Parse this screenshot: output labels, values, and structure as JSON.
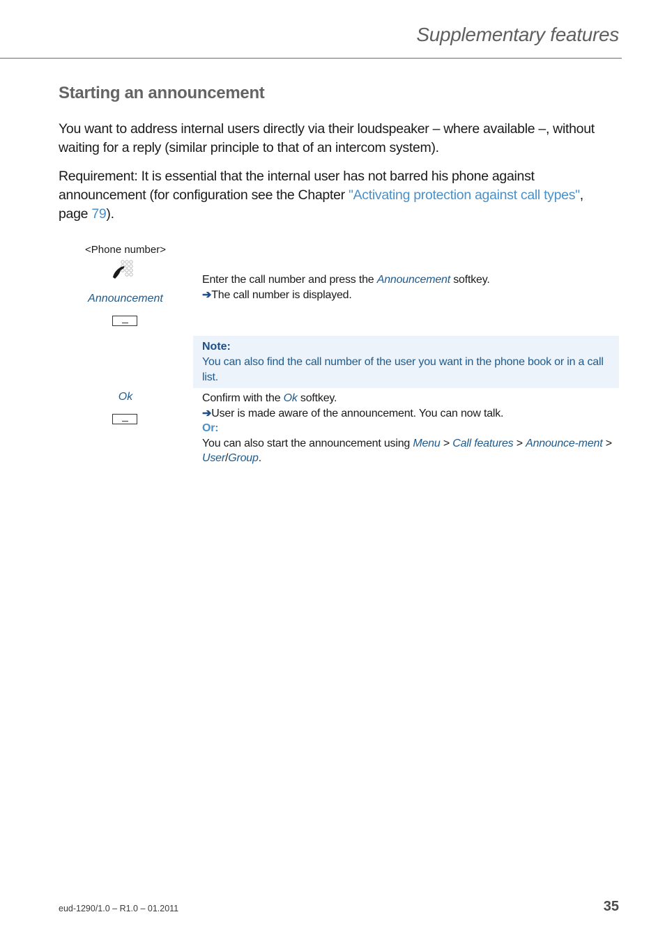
{
  "header": {
    "chapter_title": "Supplementary features"
  },
  "section": {
    "title": "Starting an announcement",
    "intro_paragraph": "You want to address internal users directly via their loudspeaker – where available –, without waiting for a reply (similar principle to that of an intercom system).",
    "requirement": {
      "text_before": "Requirement: It is essential that the internal user has not barred his phone against announcement (for configuration see the Chapter ",
      "link_text": "\"Activating protection against call types\"",
      "text_middle": ", page ",
      "page_link": "79",
      "text_after": ")."
    }
  },
  "steps": [
    {
      "left": {
        "phone_label": "<Phone number>",
        "icon": "keypad-dial-icon",
        "softkey_label": "Announcement",
        "softkey_icon": "softkey-icon"
      },
      "instruction": {
        "before": "Enter the call number and press the ",
        "softkey": "Announcement",
        "after": " softkey.",
        "arrow": "➔",
        "result": "The call number is displayed."
      }
    },
    {
      "left": {
        "softkey_label": "Ok",
        "softkey_icon": "softkey-icon"
      },
      "instruction": {
        "before": "Confirm with the ",
        "softkey": "Ok",
        "after": " softkey.",
        "arrow": "➔",
        "result": "User is made aware of the announcement. You can now talk.",
        "or_label": "Or:",
        "alt_before": "You can also start the announcement using ",
        "menu_path": [
          "Menu",
          "Call features",
          "Announce-ment",
          "User",
          "Group"
        ],
        "separator": " > ",
        "slash": "/",
        "end": "."
      }
    }
  ],
  "note": {
    "title": "Note:",
    "text": "You can also find the call number of the user you want in the phone book or in a call list."
  },
  "footer": {
    "document_ref": "eud-1290/1.0 – R1.0 – 01.2011",
    "page_number": "35"
  }
}
